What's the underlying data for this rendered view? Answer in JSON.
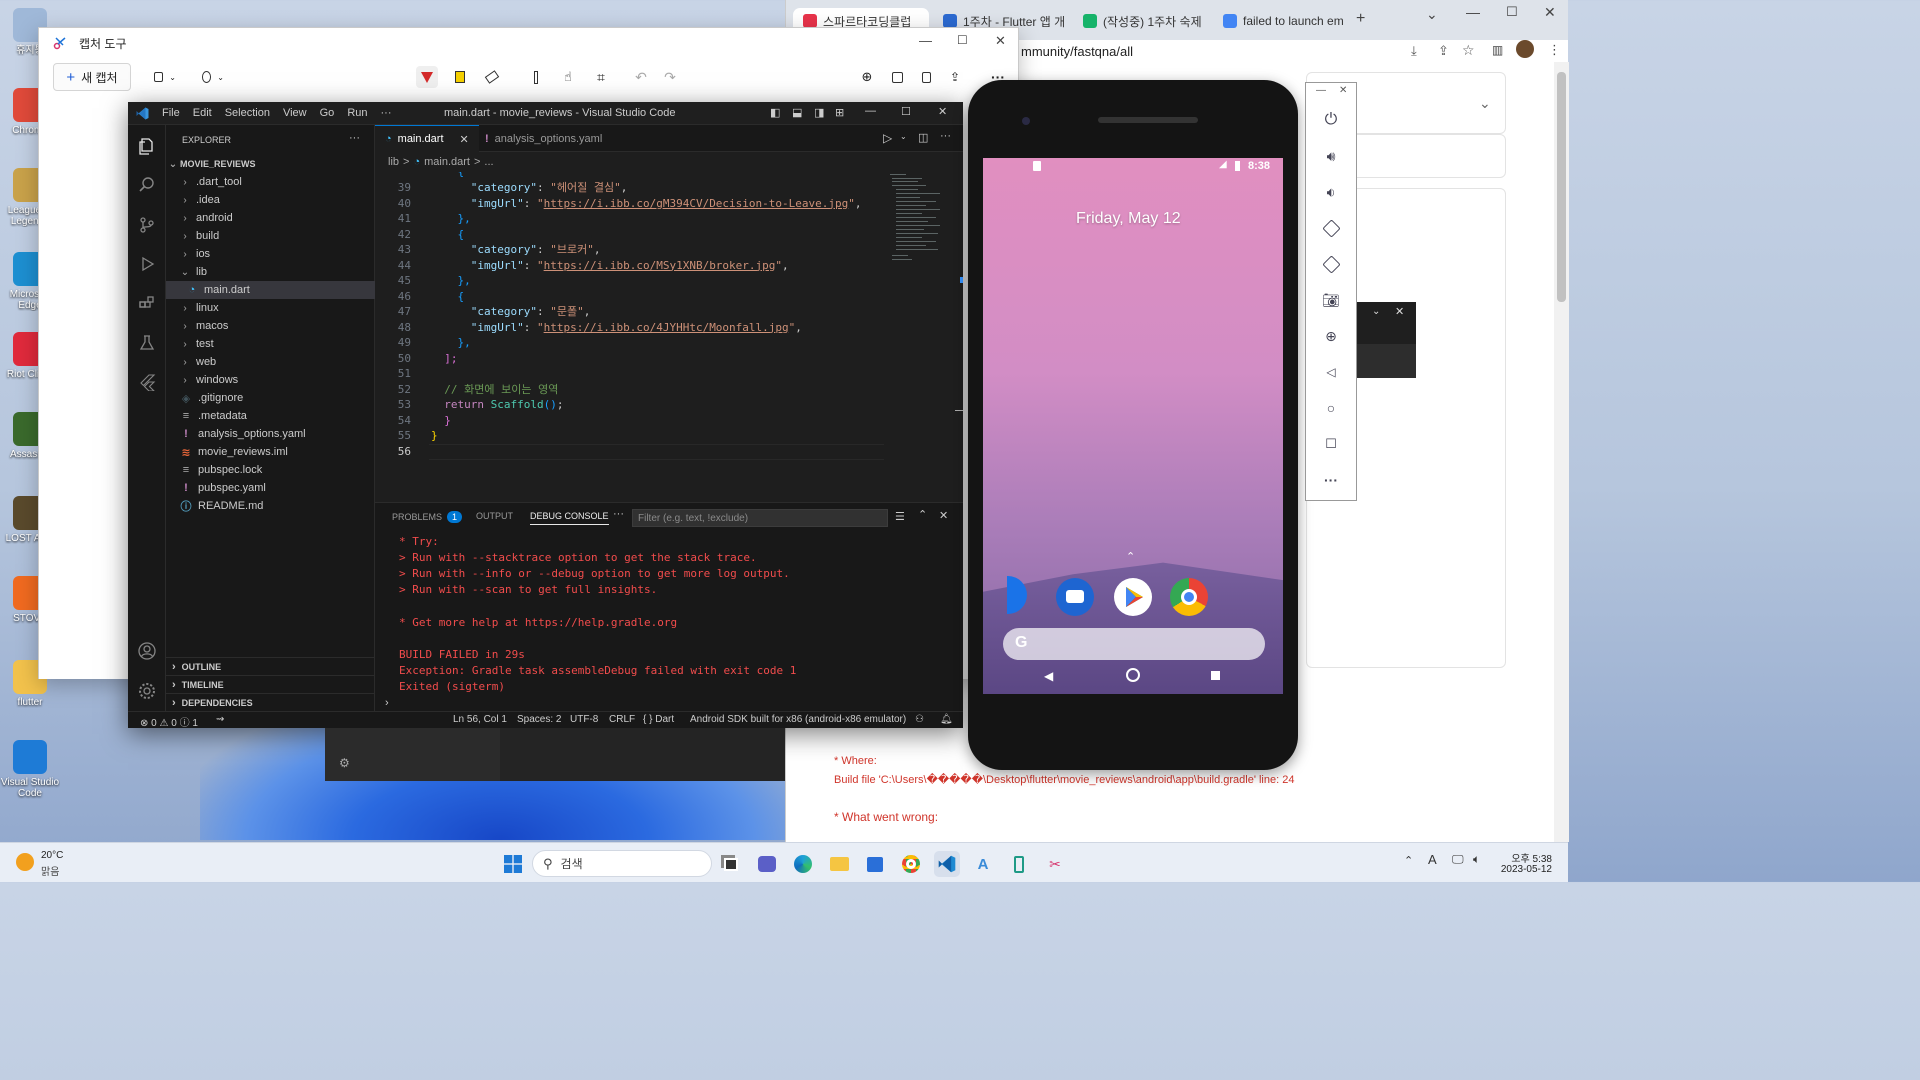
{
  "desktop": {
    "icons": [
      {
        "label": "휴지통",
        "color": "#9fb8d8"
      },
      {
        "label": "Chrome",
        "color": "#e04a3a"
      },
      {
        "label": "League of Legends",
        "color": "#c9a24a"
      },
      {
        "label": "Microsoft Edge",
        "color": "#1d8fd1"
      },
      {
        "label": "Riot Client",
        "color": "#e02a3c"
      },
      {
        "label": "Assassin",
        "color": "#3a6a2c"
      },
      {
        "label": "LOST ARK",
        "color": "#5a4a2c"
      },
      {
        "label": "STOVE",
        "color": "#f06a20"
      },
      {
        "label": "flutter",
        "color": "#f2c24c"
      },
      {
        "label": "Visual Studio Code",
        "color": "#1e7bd6"
      }
    ]
  },
  "taskbar": {
    "weather_temp": "20°C",
    "weather_desc": "맑음",
    "search_label": "검색",
    "time": "오후 5:38",
    "date": "2023-05-12"
  },
  "browser": {
    "tabs": [
      {
        "label": "스파르타코딩클럽",
        "color": "#e8334a"
      },
      {
        "label": "1주차 - Flutter 앱 개",
        "color": "#2c6ad1"
      },
      {
        "label": "(작성중) 1주차 숙제",
        "color": "#16b36a"
      },
      {
        "label": "failed to launch em",
        "color": "#4285f4"
      }
    ],
    "url": "mmunity/fastqna/all",
    "err_where": "* Where:",
    "err_build_file": "Build file 'C:\\Users\\�����\\Desktop\\flutter\\movie_reviews\\android\\app\\build.gradle' line: 24",
    "err_what": "* What went wrong:"
  },
  "capture": {
    "title": "캡처 도구",
    "new_capture": "새 캡처"
  },
  "vscode": {
    "menu": [
      "File",
      "Edit",
      "Selection",
      "View",
      "Go",
      "Run",
      "···"
    ],
    "title": "main.dart - movie_reviews - Visual Studio Code",
    "explorer_label": "EXPLORER",
    "root_label": "MOVIE_REVIEWS",
    "tree": [
      {
        "label": ".dart_tool",
        "type": "folder",
        "indent": 1,
        "open": false
      },
      {
        "label": ".idea",
        "type": "folder",
        "indent": 1,
        "open": false
      },
      {
        "label": "android",
        "type": "folder",
        "indent": 1,
        "open": false
      },
      {
        "label": "build",
        "type": "folder",
        "indent": 1,
        "open": false
      },
      {
        "label": "ios",
        "type": "folder",
        "indent": 1,
        "open": false
      },
      {
        "label": "lib",
        "type": "folder",
        "indent": 1,
        "open": true
      },
      {
        "label": "main.dart",
        "type": "dart",
        "indent": 2,
        "selected": true
      },
      {
        "label": "linux",
        "type": "folder",
        "indent": 1,
        "open": false
      },
      {
        "label": "macos",
        "type": "folder",
        "indent": 1,
        "open": false
      },
      {
        "label": "test",
        "type": "folder",
        "indent": 1,
        "open": false
      },
      {
        "label": "web",
        "type": "folder",
        "indent": 1,
        "open": false
      },
      {
        "label": "windows",
        "type": "folder",
        "indent": 1,
        "open": false
      },
      {
        "label": ".gitignore",
        "type": "git",
        "indent": 1
      },
      {
        "label": ".metadata",
        "type": "meta",
        "indent": 1
      },
      {
        "label": "analysis_options.yaml",
        "type": "yaml",
        "indent": 1
      },
      {
        "label": "movie_reviews.iml",
        "type": "iml",
        "indent": 1
      },
      {
        "label": "pubspec.lock",
        "type": "meta",
        "indent": 1
      },
      {
        "label": "pubspec.yaml",
        "type": "yaml",
        "indent": 1
      },
      {
        "label": "README.md",
        "type": "info",
        "indent": 1
      }
    ],
    "sections": [
      "OUTLINE",
      "TIMELINE",
      "DEPENDENCIES"
    ],
    "tabs": [
      {
        "label": "main.dart",
        "active": true
      },
      {
        "label": "analysis_options.yaml",
        "active": false
      }
    ],
    "breadcrumb": [
      "lib",
      ">",
      "main.dart",
      ">",
      "..."
    ],
    "code": [
      {
        "n": "39",
        "indent": "      ",
        "key": "category",
        "val": "헤어질 결심",
        "kind": "pair"
      },
      {
        "n": "40",
        "indent": "      ",
        "key": "imgUrl",
        "val": "https://i.ibb.co/gM394CV/Decision-to-Leave.jpg",
        "kind": "url"
      },
      {
        "n": "41",
        "indent": "    ",
        "text": "},",
        "kind": "close"
      },
      {
        "n": "42",
        "indent": "    ",
        "text": "{",
        "kind": "open"
      },
      {
        "n": "43",
        "indent": "      ",
        "key": "category",
        "val": "브로커",
        "kind": "pair"
      },
      {
        "n": "44",
        "indent": "      ",
        "key": "imgUrl",
        "val": "https://i.ibb.co/MSy1XNB/broker.jpg",
        "kind": "url"
      },
      {
        "n": "45",
        "indent": "    ",
        "text": "},",
        "kind": "close"
      },
      {
        "n": "46",
        "indent": "    ",
        "text": "{",
        "kind": "open"
      },
      {
        "n": "47",
        "indent": "      ",
        "key": "category",
        "val": "문폴",
        "kind": "pair"
      },
      {
        "n": "48",
        "indent": "      ",
        "key": "imgUrl",
        "val": "https://i.ibb.co/4JYHHtc/Moonfall.jpg",
        "kind": "url"
      },
      {
        "n": "49",
        "indent": "    ",
        "text": "},",
        "kind": "close"
      },
      {
        "n": "50",
        "indent": "  ",
        "text": "];",
        "kind": "array"
      },
      {
        "n": "51",
        "indent": "",
        "text": "",
        "kind": "blank"
      },
      {
        "n": "52",
        "indent": "  ",
        "text": "// 화면에 보이는 영역",
        "kind": "comment"
      },
      {
        "n": "53",
        "indent": "  ",
        "text": "return Scaffold();",
        "kind": "return"
      },
      {
        "n": "54",
        "indent": "",
        "text": "  }",
        "kind": "brace"
      },
      {
        "n": "55",
        "indent": "",
        "text": "}",
        "kind": "brace2"
      },
      {
        "n": "56",
        "indent": "",
        "text": "",
        "kind": "blank"
      }
    ],
    "panel": {
      "tabs": [
        "PROBLEMS",
        "OUTPUT",
        "DEBUG CONSOLE",
        "···"
      ],
      "problems_count": "1",
      "filter_placeholder": "Filter (e.g. text, !exclude)",
      "console": [
        "* Try:",
        "> Run with --stacktrace option to get the stack trace.",
        "> Run with --info or --debug option to get more log output.",
        "> Run with --scan to get full insights.",
        "",
        "* Get more help at https://help.gradle.org",
        "",
        "BUILD FAILED in 29s",
        "Exception: Gradle task assembleDebug failed with exit code 1",
        "Exited (sigterm)"
      ]
    },
    "status": {
      "problems": "⊗ 0 ⚠ 0 ⓘ 1",
      "cursor": "Ln 56, Col 1",
      "spaces": "Spaces: 2",
      "encoding": "UTF-8",
      "eol": "CRLF",
      "lang": "{ } Dart",
      "device": "Android SDK built for x86 (android-x86 emulator)"
    }
  },
  "emulator": {
    "time": "8:38",
    "date": "Friday, May 12"
  }
}
